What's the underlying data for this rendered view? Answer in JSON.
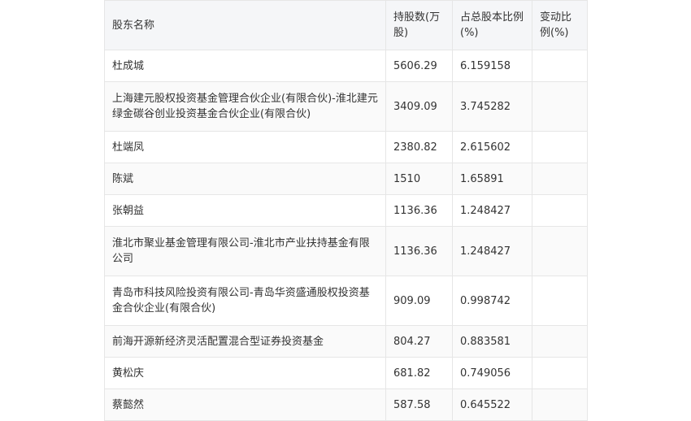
{
  "table": {
    "headers": [
      "股东名称",
      "持股数(万股)",
      "占总股本比例(%)",
      "变动比例(%)"
    ],
    "rows": [
      {
        "name": "杜成城",
        "shares": "5606.29",
        "ratio": "6.159158",
        "change": ""
      },
      {
        "name": "上海建元股权投资基金管理合伙企业(有限合伙)-淮北建元绿金碳谷创业投资基金合伙企业(有限合伙)",
        "shares": "3409.09",
        "ratio": "3.745282",
        "change": ""
      },
      {
        "name": "杜端凤",
        "shares": "2380.82",
        "ratio": "2.615602",
        "change": ""
      },
      {
        "name": "陈斌",
        "shares": "1510",
        "ratio": "1.65891",
        "change": ""
      },
      {
        "name": "张朝益",
        "shares": "1136.36",
        "ratio": "1.248427",
        "change": ""
      },
      {
        "name": "淮北市聚业基金管理有限公司-淮北市产业扶持基金有限公司",
        "shares": "1136.36",
        "ratio": "1.248427",
        "change": ""
      },
      {
        "name": "青岛市科技风险投资有限公司-青岛华资盛通股权投资基金合伙企业(有限合伙)",
        "shares": "909.09",
        "ratio": "0.998742",
        "change": ""
      },
      {
        "name": "前海开源新经济灵活配置混合型证券投资基金",
        "shares": "804.27",
        "ratio": "0.883581",
        "change": ""
      },
      {
        "name": "黄松庆",
        "shares": "681.82",
        "ratio": "0.749056",
        "change": ""
      },
      {
        "name": "蔡懿然",
        "shares": "587.58",
        "ratio": "0.645522",
        "change": ""
      }
    ]
  }
}
